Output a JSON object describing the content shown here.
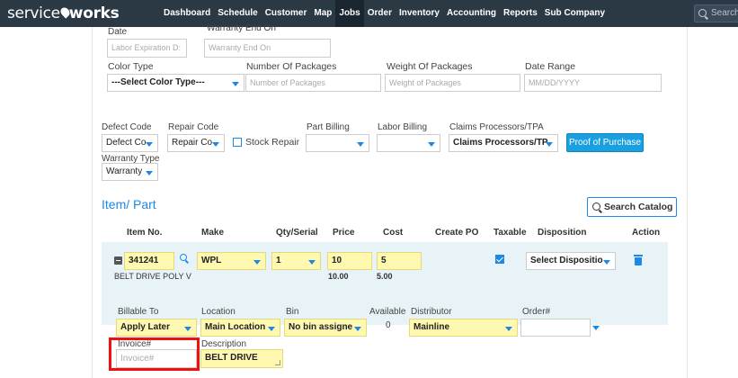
{
  "nav": {
    "logo_light": "service",
    "logo_bold": "works",
    "items": [
      {
        "label": "Dashboard"
      },
      {
        "label": "Schedule"
      },
      {
        "label": "Customer"
      },
      {
        "label": "Map"
      },
      {
        "label": "Jobs",
        "active": true
      },
      {
        "label": "Order"
      },
      {
        "label": "Inventory"
      },
      {
        "label": "Accounting"
      },
      {
        "label": "Reports"
      },
      {
        "label": "Sub Company"
      }
    ],
    "search_placeholder": "Search"
  },
  "form_top": {
    "date_label": "Date",
    "labor_expiration_placeholder": "Labor Expiration D:",
    "warranty_end_label": "Warranty End On",
    "warranty_end_placeholder": "Warranty End On",
    "color_type_label": "Color Type",
    "color_type_value": "---Select Color Type---",
    "packages_label": "Number Of Packages",
    "packages_placeholder": "Number of Packages",
    "weight_label": "Weight Of Packages",
    "weight_placeholder": "Weight of Packages",
    "date_range_label": "Date Range",
    "date_range_placeholder": "MM/DD/YYYY"
  },
  "codes": {
    "defect_code_label": "Defect Code",
    "defect_code_value": "Defect Co",
    "repair_code_label": "Repair Code",
    "repair_code_value": "Repair Co",
    "stock_repair_label": "Stock Repair",
    "part_billing_label": "Part Billing",
    "labor_billing_label": "Labor Billing",
    "claims_label": "Claims Processors/TPA",
    "claims_value": "Claims Processors/TP.",
    "proof_button": "Proof of Purchase",
    "warranty_type_label": "Warranty Type",
    "warranty_type_value": "Warranty"
  },
  "items_section": {
    "title": "Item/ Part",
    "search_catalog": "Search Catalog",
    "columns": [
      "Item No.",
      "Make",
      "Qty/Serial",
      "Price",
      "Cost",
      "Create PO",
      "Taxable",
      "Disposition",
      "Action"
    ],
    "row": {
      "item_no": "341241",
      "description_text": "BELT DRIVE POLY V",
      "make": "WPL",
      "qty": "1",
      "price": "10",
      "price_total": "10.00",
      "cost": "5",
      "cost_total": "5.00",
      "taxable": true,
      "disposition": "Select Dispositio"
    },
    "details": {
      "billable_to_label": "Billable To",
      "billable_to_value": "Apply Later",
      "location_label": "Location",
      "location_value": "Main Location",
      "bin_label": "Bin",
      "bin_value": "No bin assigne",
      "available_label": "Available",
      "available_value": "0",
      "distributor_label": "Distributor",
      "distributor_value": "Mainline",
      "order_label": "Order#",
      "invoice_label": "Invoice#",
      "invoice_placeholder": "Invoice#",
      "description_label": "Description",
      "description_value": "BELT DRIVE"
    }
  },
  "colors": {
    "nav_bg": "#2b3945",
    "accent": "#1e88e5",
    "button_blue": "#1aa0e0",
    "highlight_yellow": "#fff8b0",
    "row_bg": "#e8f3f7",
    "red_highlight": "#ee1111"
  }
}
